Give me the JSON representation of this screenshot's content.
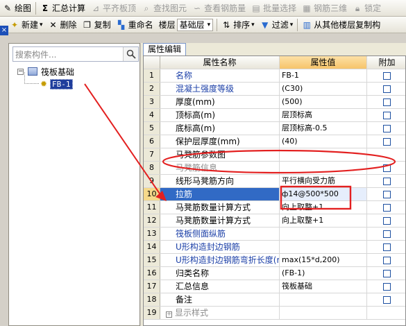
{
  "toolbar1": {
    "draw": "绘图",
    "summary": "汇总计算",
    "flush_slab": "平齐板顶",
    "find_element": "查找图元",
    "view_rebar": "查看钢筋量",
    "batch_select": "批量选择",
    "rebar_3d": "钢筋三维",
    "lock": "锁定"
  },
  "toolbar2": {
    "new": "新建",
    "delete": "删除",
    "copy": "复制",
    "rename": "重命名",
    "floor_label": "楼层",
    "floor_value": "基础层",
    "sort": "排序",
    "filter": "过滤",
    "copy_from_floor": "从其他楼层复制构"
  },
  "left_strip": "×",
  "search": {
    "placeholder": "搜索构件..."
  },
  "tree": {
    "root": "筏板基础",
    "child": "FB-1"
  },
  "prop_tab": "属性编辑",
  "grid": {
    "headers": {
      "name": "属性名称",
      "value": "属性值",
      "add": "附加"
    },
    "rows": [
      {
        "num": "1",
        "name": "名称",
        "value": "FB-1"
      },
      {
        "num": "2",
        "name": "混凝土强度等级",
        "value": "(C30)"
      },
      {
        "num": "3",
        "name": "厚度(mm)",
        "value": "(500)"
      },
      {
        "num": "4",
        "name": "顶标高(m)",
        "value": "层顶标高"
      },
      {
        "num": "5",
        "name": "底标高(m)",
        "value": "层顶标高-0.5"
      },
      {
        "num": "6",
        "name": "保护层厚度(mm)",
        "value": "(40)"
      },
      {
        "num": "7",
        "name": "马凳筋参数图",
        "value": ""
      },
      {
        "num": "8",
        "name": "马凳筋信息",
        "value": ""
      },
      {
        "num": "9",
        "name": "线形马凳筋方向",
        "value": "平行横向受力筋"
      },
      {
        "num": "10",
        "name": "拉筋",
        "value": "ф14@500*500"
      },
      {
        "num": "11",
        "name": "马凳筋数量计算方式",
        "value": "向上取整+1"
      },
      {
        "num": "12",
        "name": "马凳筋数量计算方式",
        "value": "向上取整+1"
      },
      {
        "num": "13",
        "name": "筏板侧面纵筋",
        "value": ""
      },
      {
        "num": "14",
        "name": "U形构造封边钢筋",
        "value": ""
      },
      {
        "num": "15",
        "name": "U形构造封边钢筋弯折长度(mm)",
        "value": "max(15*d,200)"
      },
      {
        "num": "16",
        "name": "归类名称",
        "value": "(FB-1)"
      },
      {
        "num": "17",
        "name": "汇总信息",
        "value": "筏板基础"
      },
      {
        "num": "18",
        "name": "备注",
        "value": ""
      },
      {
        "num": "19",
        "name": "显示样式",
        "value": ""
      }
    ]
  },
  "colors": {
    "annotation": "#e32020",
    "selection": "#316ac5",
    "label_blue": "#1b3fa7"
  }
}
